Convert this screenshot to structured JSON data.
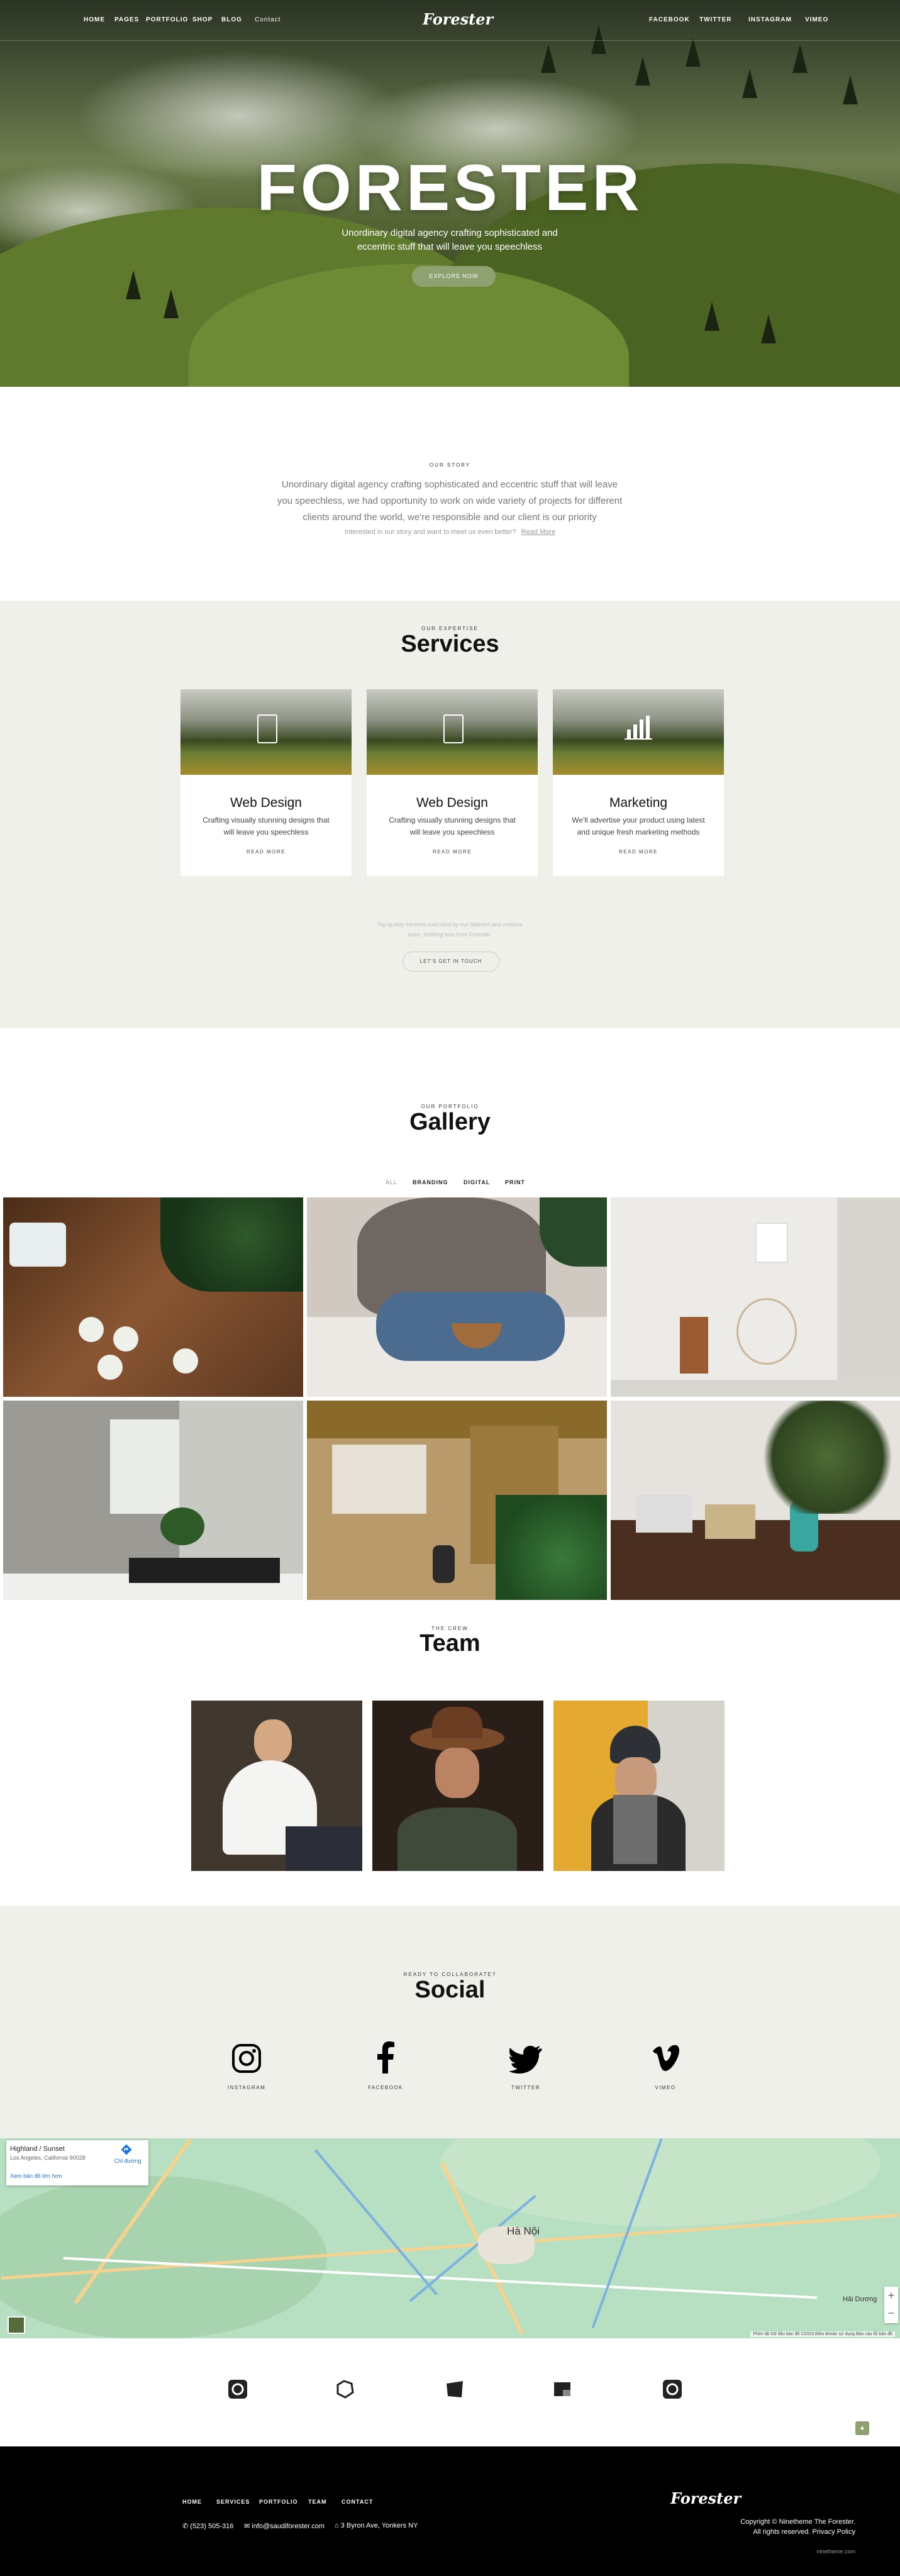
{
  "nav": {
    "left": [
      "HOME",
      "PAGES",
      "PORTFOLIO",
      "SHOP",
      "BLOG",
      "Contact"
    ],
    "brand": "Forester",
    "right": [
      "FACEBOOK",
      "TWITTER",
      "INSTAGRAM",
      "VIMEO"
    ]
  },
  "hero": {
    "title": "FORESTER",
    "subtitle": "Unordinary digital agency crafting sophisticated and eccentric stuff that will leave you speechless",
    "button": "EXPLORE NOW"
  },
  "story": {
    "eyebrow": "OUR STORY",
    "text": "Unordinary digital agency crafting sophisticated and eccentric stuff that will leave you speechless, we had opportunity to work on wide variety of projects for different clients around the world, we're responsible and our client is our priority",
    "note": "Interested in our story and want to meet us even better?",
    "note_link": "Read More"
  },
  "services": {
    "eyebrow": "OUR EXPERTISE",
    "title": "Services",
    "items": [
      {
        "title": "Web Design",
        "text": "Crafting visually stunning designs that will leave you speechless",
        "link": "READ MORE",
        "icon": "mobile-design-icon"
      },
      {
        "title": "Web Design",
        "text": "Crafting visually stunning designs that will leave you speechless",
        "link": "READ MORE",
        "icon": "mobile-design-icon"
      },
      {
        "title": "Marketing",
        "text": "We'll advertise your product using latest and unique fresh marketing methods",
        "link": "READ MORE",
        "icon": "bar-chart-icon"
      }
    ],
    "note": "Top quality services executed by our talented and creative team. Nothing less from Forester.",
    "button": "LET'S GET IN TOUCH"
  },
  "gallery": {
    "eyebrow": "OUR PORTFOLIO",
    "title": "Gallery",
    "filters": [
      "ALL",
      "BRANDING",
      "DIGITAL",
      "PRINT"
    ],
    "active_filter": "ALL"
  },
  "team": {
    "eyebrow": "THE CREW",
    "title": "Team"
  },
  "social": {
    "eyebrow": "READY TO COLLABORATE?",
    "title": "Social",
    "items": [
      {
        "label": "INSTAGRAM",
        "icon": "instagram-icon"
      },
      {
        "label": "FACEBOOK",
        "icon": "facebook-icon"
      },
      {
        "label": "TWITTER",
        "icon": "twitter-icon"
      },
      {
        "label": "VIMEO",
        "icon": "vimeo-icon"
      }
    ]
  },
  "map": {
    "place_title": "Highland / Sunset",
    "place_address": "Los Angeles, California 90028",
    "directions": "Chỉ đường",
    "larger_map": "Xem bản đồ lớn hơn",
    "city_label": "Hà Nội",
    "city2_label": "Hải Dương",
    "attribution": "Phím tắt   Dữ liệu bản đồ ©2023   Điều khoản sử dụng   Báo cáo lỗi bản đồ"
  },
  "footer": {
    "nav": [
      "HOME",
      "SERVICES",
      "PORTFOLIO",
      "TEAM",
      "CONTACT"
    ],
    "phone": "(523) 505-316",
    "email": "info@saudiforester.com",
    "address": "3 Byron Ave, Yonkers NY",
    "brand": "Forester",
    "copyright": "Copyright © Ninetheme The Forester.",
    "rights": "All rights reserved.",
    "privacy": "Privacy Policy",
    "site": "ninetheme.com"
  },
  "colors": {
    "accent": "#8ea170",
    "section_bg": "#f0f0ea",
    "footer_bg": "#000000"
  }
}
